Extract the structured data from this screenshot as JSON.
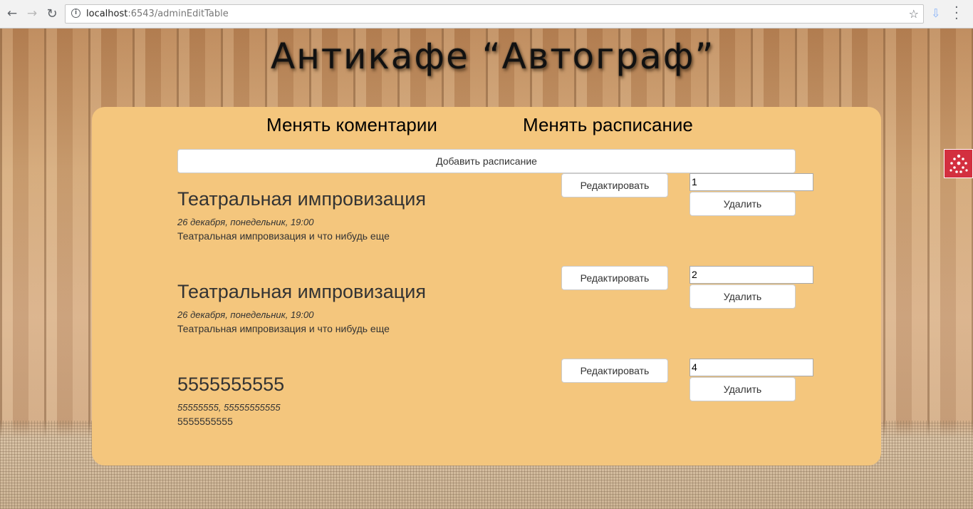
{
  "browser": {
    "url_host": "localhost",
    "url_rest": ":6543/adminEditTable"
  },
  "logo": {
    "text": "Антикафе  “Автограф”"
  },
  "nav": {
    "comments_link": "Менять коментарии",
    "schedule_link": "Менять расписание"
  },
  "actions": {
    "add_schedule": "Добавить расписание"
  },
  "schedule": [
    {
      "title": "Театральная импровизация",
      "date": "26 декабря, понедельник, 19:00",
      "description": "Театральная импровизация и что нибудь еще",
      "id_value": "1",
      "edit_label": "Редактировать",
      "delete_label": "Удалить"
    },
    {
      "title": "Театральная импровизация",
      "date": "26 декабря, понедельник, 19:00",
      "description": "Театральная импровизация и что нибудь еще",
      "id_value": "2",
      "edit_label": "Редактировать",
      "delete_label": "Удалить"
    },
    {
      "title": "5555555555",
      "date": "55555555, 55555555555",
      "description": "5555555555",
      "id_value": "4",
      "edit_label": "Редактировать",
      "delete_label": "Удалить"
    }
  ],
  "colors": {
    "panel": "#f4c67d",
    "widget": "#d32f3f"
  }
}
